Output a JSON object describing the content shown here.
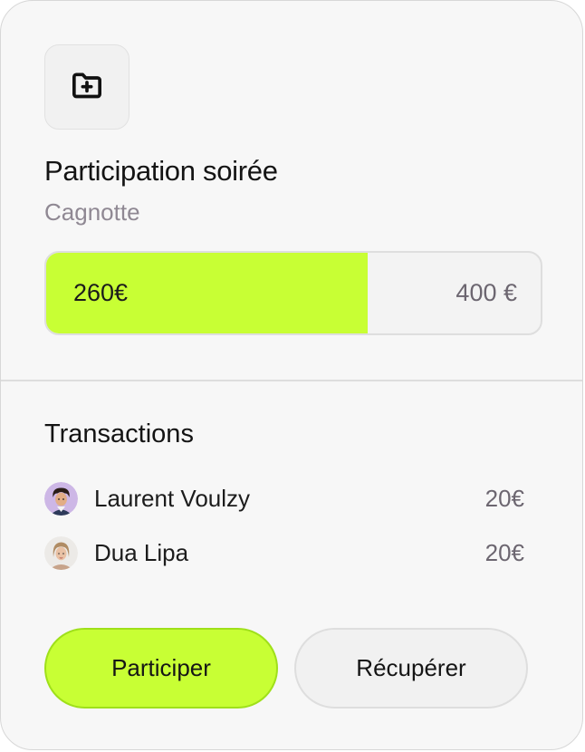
{
  "card": {
    "icon": "folder-plus-icon",
    "title": "Participation soirée",
    "subtitle": "Cagnotte"
  },
  "progress": {
    "current_label": "260€",
    "target_label": "400 €",
    "current_value": 260,
    "target_value": 400,
    "fill_color": "#c8ff34"
  },
  "transactions": {
    "title": "Transactions",
    "items": [
      {
        "name": "Laurent Voulzy",
        "amount": "20€",
        "avatar": "avatar-laurent-voulzy"
      },
      {
        "name": "Dua Lipa",
        "amount": "20€",
        "avatar": "avatar-dua-lipa"
      }
    ]
  },
  "actions": {
    "primary_label": "Participer",
    "secondary_label": "Récupérer"
  },
  "colors": {
    "accent": "#c8ff34",
    "accent_border": "#9fe01a",
    "muted_text": "#8f8893",
    "card_background": "#f7f7f7"
  }
}
